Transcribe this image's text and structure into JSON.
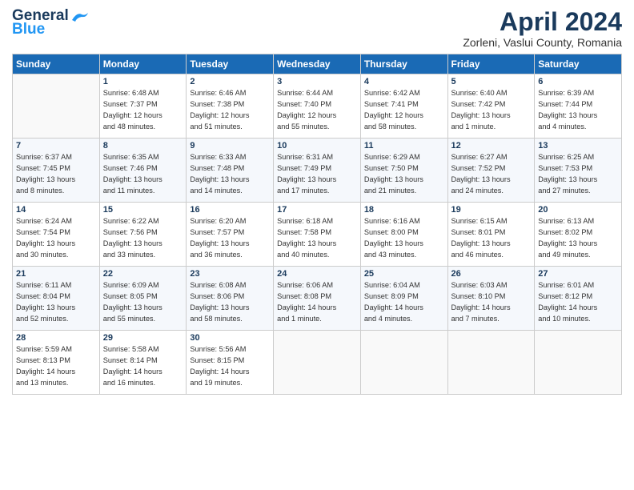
{
  "logo": {
    "line1": "General",
    "line2": "Blue"
  },
  "title": "April 2024",
  "location": "Zorleni, Vaslui County, Romania",
  "days_header": [
    "Sunday",
    "Monday",
    "Tuesday",
    "Wednesday",
    "Thursday",
    "Friday",
    "Saturday"
  ],
  "weeks": [
    [
      {
        "day": "",
        "info": ""
      },
      {
        "day": "1",
        "info": "Sunrise: 6:48 AM\nSunset: 7:37 PM\nDaylight: 12 hours\nand 48 minutes."
      },
      {
        "day": "2",
        "info": "Sunrise: 6:46 AM\nSunset: 7:38 PM\nDaylight: 12 hours\nand 51 minutes."
      },
      {
        "day": "3",
        "info": "Sunrise: 6:44 AM\nSunset: 7:40 PM\nDaylight: 12 hours\nand 55 minutes."
      },
      {
        "day": "4",
        "info": "Sunrise: 6:42 AM\nSunset: 7:41 PM\nDaylight: 12 hours\nand 58 minutes."
      },
      {
        "day": "5",
        "info": "Sunrise: 6:40 AM\nSunset: 7:42 PM\nDaylight: 13 hours\nand 1 minute."
      },
      {
        "day": "6",
        "info": "Sunrise: 6:39 AM\nSunset: 7:44 PM\nDaylight: 13 hours\nand 4 minutes."
      }
    ],
    [
      {
        "day": "7",
        "info": "Sunrise: 6:37 AM\nSunset: 7:45 PM\nDaylight: 13 hours\nand 8 minutes."
      },
      {
        "day": "8",
        "info": "Sunrise: 6:35 AM\nSunset: 7:46 PM\nDaylight: 13 hours\nand 11 minutes."
      },
      {
        "day": "9",
        "info": "Sunrise: 6:33 AM\nSunset: 7:48 PM\nDaylight: 13 hours\nand 14 minutes."
      },
      {
        "day": "10",
        "info": "Sunrise: 6:31 AM\nSunset: 7:49 PM\nDaylight: 13 hours\nand 17 minutes."
      },
      {
        "day": "11",
        "info": "Sunrise: 6:29 AM\nSunset: 7:50 PM\nDaylight: 13 hours\nand 21 minutes."
      },
      {
        "day": "12",
        "info": "Sunrise: 6:27 AM\nSunset: 7:52 PM\nDaylight: 13 hours\nand 24 minutes."
      },
      {
        "day": "13",
        "info": "Sunrise: 6:25 AM\nSunset: 7:53 PM\nDaylight: 13 hours\nand 27 minutes."
      }
    ],
    [
      {
        "day": "14",
        "info": "Sunrise: 6:24 AM\nSunset: 7:54 PM\nDaylight: 13 hours\nand 30 minutes."
      },
      {
        "day": "15",
        "info": "Sunrise: 6:22 AM\nSunset: 7:56 PM\nDaylight: 13 hours\nand 33 minutes."
      },
      {
        "day": "16",
        "info": "Sunrise: 6:20 AM\nSunset: 7:57 PM\nDaylight: 13 hours\nand 36 minutes."
      },
      {
        "day": "17",
        "info": "Sunrise: 6:18 AM\nSunset: 7:58 PM\nDaylight: 13 hours\nand 40 minutes."
      },
      {
        "day": "18",
        "info": "Sunrise: 6:16 AM\nSunset: 8:00 PM\nDaylight: 13 hours\nand 43 minutes."
      },
      {
        "day": "19",
        "info": "Sunrise: 6:15 AM\nSunset: 8:01 PM\nDaylight: 13 hours\nand 46 minutes."
      },
      {
        "day": "20",
        "info": "Sunrise: 6:13 AM\nSunset: 8:02 PM\nDaylight: 13 hours\nand 49 minutes."
      }
    ],
    [
      {
        "day": "21",
        "info": "Sunrise: 6:11 AM\nSunset: 8:04 PM\nDaylight: 13 hours\nand 52 minutes."
      },
      {
        "day": "22",
        "info": "Sunrise: 6:09 AM\nSunset: 8:05 PM\nDaylight: 13 hours\nand 55 minutes."
      },
      {
        "day": "23",
        "info": "Sunrise: 6:08 AM\nSunset: 8:06 PM\nDaylight: 13 hours\nand 58 minutes."
      },
      {
        "day": "24",
        "info": "Sunrise: 6:06 AM\nSunset: 8:08 PM\nDaylight: 14 hours\nand 1 minute."
      },
      {
        "day": "25",
        "info": "Sunrise: 6:04 AM\nSunset: 8:09 PM\nDaylight: 14 hours\nand 4 minutes."
      },
      {
        "day": "26",
        "info": "Sunrise: 6:03 AM\nSunset: 8:10 PM\nDaylight: 14 hours\nand 7 minutes."
      },
      {
        "day": "27",
        "info": "Sunrise: 6:01 AM\nSunset: 8:12 PM\nDaylight: 14 hours\nand 10 minutes."
      }
    ],
    [
      {
        "day": "28",
        "info": "Sunrise: 5:59 AM\nSunset: 8:13 PM\nDaylight: 14 hours\nand 13 minutes."
      },
      {
        "day": "29",
        "info": "Sunrise: 5:58 AM\nSunset: 8:14 PM\nDaylight: 14 hours\nand 16 minutes."
      },
      {
        "day": "30",
        "info": "Sunrise: 5:56 AM\nSunset: 8:15 PM\nDaylight: 14 hours\nand 19 minutes."
      },
      {
        "day": "",
        "info": ""
      },
      {
        "day": "",
        "info": ""
      },
      {
        "day": "",
        "info": ""
      },
      {
        "day": "",
        "info": ""
      }
    ]
  ]
}
